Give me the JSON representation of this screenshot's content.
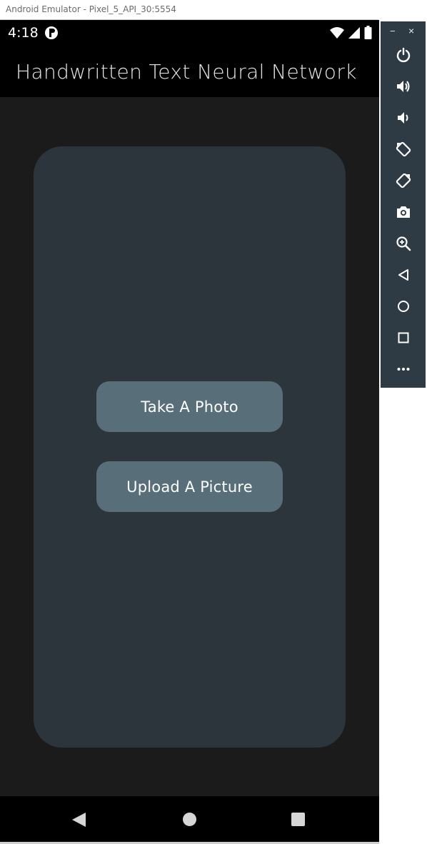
{
  "window": {
    "title": "Android Emulator - Pixel_5_API_30:5554"
  },
  "status_bar": {
    "time": "4:18",
    "icons": [
      "app-notification-icon",
      "wifi-icon",
      "signal-icon",
      "battery-icon"
    ]
  },
  "app_bar": {
    "title": "Handwritten Text Neural Network"
  },
  "main": {
    "buttons": [
      {
        "label": "Take A Photo"
      },
      {
        "label": "Upload A Picture"
      }
    ]
  },
  "nav_bar": {
    "icons": [
      "back-icon",
      "home-icon",
      "recents-icon"
    ]
  },
  "emulator_toolbar": {
    "window_controls": {
      "minimize": "−",
      "close": "×"
    },
    "icons": [
      "power-icon",
      "volume-up-icon",
      "volume-down-icon",
      "rotate-left-icon",
      "rotate-right-icon",
      "camera-icon",
      "zoom-icon",
      "back-icon",
      "home-icon",
      "overview-icon",
      "more-icon"
    ]
  },
  "colors": {
    "background": "#1b1b1b",
    "card": "#2c353c",
    "button": "#586e79",
    "toolbar": "#2e3b45",
    "appbar": "#000000"
  }
}
